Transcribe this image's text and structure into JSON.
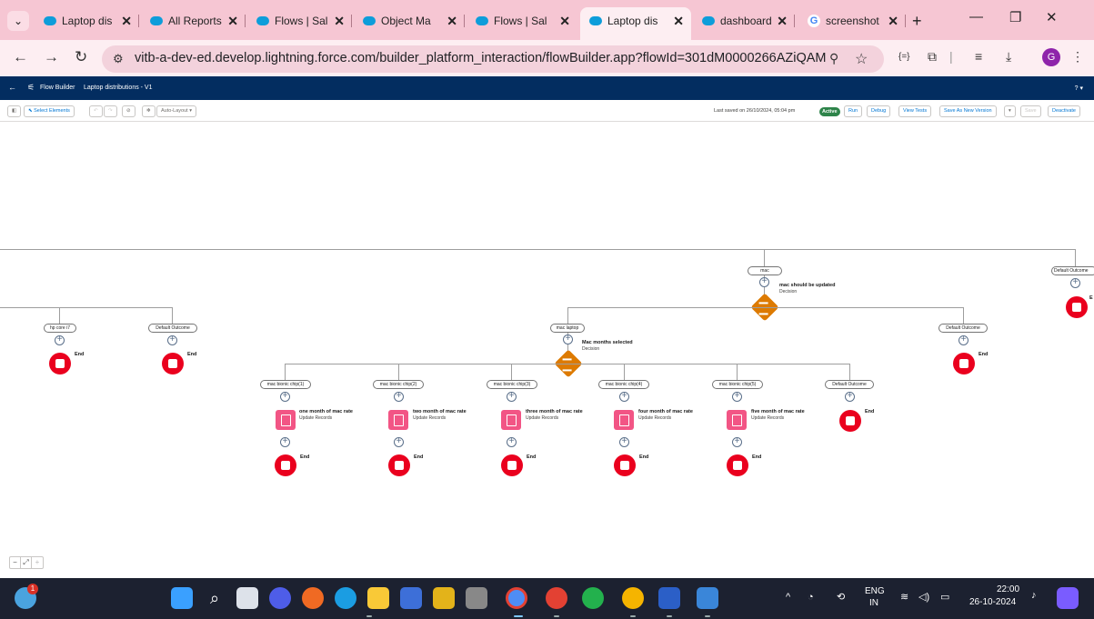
{
  "browser": {
    "tabs": [
      {
        "label": "Laptop dis",
        "active": false
      },
      {
        "label": "All Reports",
        "active": false
      },
      {
        "label": "Flows | Sal",
        "active": false
      },
      {
        "label": "Object Ma",
        "active": false
      },
      {
        "label": "Flows | Sal",
        "active": false
      },
      {
        "label": "Laptop dis",
        "active": true
      },
      {
        "label": "dashboard",
        "active": false
      },
      {
        "label": "screenshot",
        "active": false
      }
    ],
    "new_tab": "+",
    "url": "vitb-a-dev-ed.develop.lightning.force.com/builder_platform_interaction/flowBuilder.app?flowId=301dM0000266AZiQAM",
    "profile_initial": "G"
  },
  "header": {
    "app_name": "Flow Builder",
    "flow_title": "Laptop distributions - V1",
    "help": "? ▾"
  },
  "toolbar": {
    "select_elements": "Select Elements",
    "auto_layout": "Auto-Layout",
    "last_saved": "Last saved on 26/10/2024, 05:04 pm",
    "status": "Active",
    "run": "Run",
    "debug": "Debug",
    "view_tests": "View Tests",
    "save_as_new_version": "Save As New Version",
    "save": "Save",
    "deactivate": "Deactivate"
  },
  "canvas": {
    "mac_outcome": "mac",
    "top_default_outcome": "Default Outcome",
    "mac_decision": {
      "label": "mac should be updated",
      "type": "Decision"
    },
    "left_outcomes": [
      "hp core i7",
      "Default Outcome"
    ],
    "mac_laptop_outcome": "mac laptop",
    "mac_default_outcome": "Default Outcome",
    "months_decision": {
      "label": "Mac months selected",
      "type": "Decision"
    },
    "chip_outcomes": [
      "mac bionic chip(1)",
      "mac bionic chip(2)",
      "mac bionic chip(3)",
      "mac bionic chip(4)",
      "mac bionic chip(5)",
      "Default Outcome"
    ],
    "updates": [
      {
        "label": "one month of mac rate",
        "type": "Update Records"
      },
      {
        "label": "two month of mac rate",
        "type": "Update Records"
      },
      {
        "label": "three month of mac rate",
        "type": "Update Records"
      },
      {
        "label": "four month of mac rate",
        "type": "Update Records"
      },
      {
        "label": "five month of mac rate",
        "type": "Update Records"
      }
    ],
    "end_label": "End",
    "partial_end_label": "E"
  },
  "taskbar": {
    "notification_count": "1",
    "language": "ENG",
    "region": "IN",
    "time": "22:00",
    "date": "26-10-2024"
  }
}
